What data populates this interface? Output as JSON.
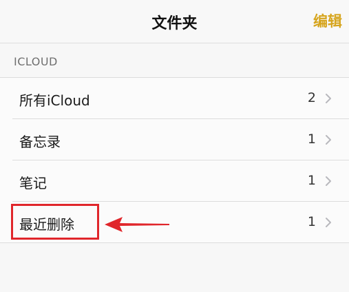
{
  "navbar": {
    "title": "文件夹",
    "edit_label": "编辑"
  },
  "section": {
    "header": "ICLOUD"
  },
  "folders": [
    {
      "label": "所有iCloud",
      "count": "2"
    },
    {
      "label": "备忘录",
      "count": "1"
    },
    {
      "label": "笔记",
      "count": "1"
    },
    {
      "label": "最近删除",
      "count": "1"
    }
  ],
  "colors": {
    "accent": "#d6a51e",
    "annotation": "#e0262b"
  },
  "icons": {
    "row_disclosure": "chevron-right-icon"
  }
}
